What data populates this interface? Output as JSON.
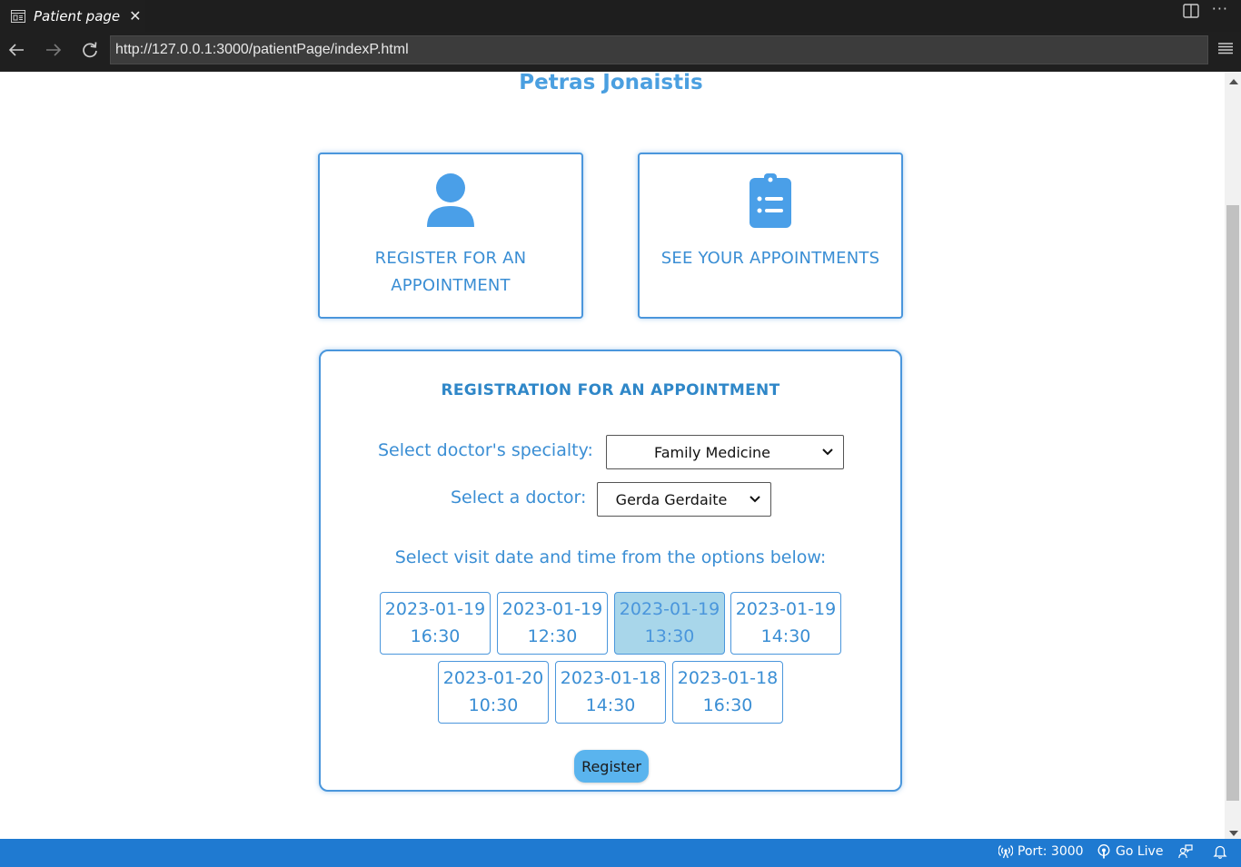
{
  "tab": {
    "title": "Patient page",
    "close_glyph": "✕",
    "icon": "preview-icon"
  },
  "tabbar_actions": {
    "split_icon": "split-editor-icon",
    "more_glyph": "···"
  },
  "addressbar": {
    "url": "http://127.0.0.1:3000/patientPage/indexP.html"
  },
  "page": {
    "patient_name": "Petras Jonaistis",
    "cards": [
      {
        "label": "REGISTER FOR AN APPOINTMENT",
        "icon": "user-icon"
      },
      {
        "label": "SEE YOUR APPOINTMENTS",
        "icon": "clipboard-list-icon"
      }
    ],
    "form": {
      "title": "REGISTRATION FOR AN APPOINTMENT",
      "specialty_label": "Select doctor's specialty:",
      "specialty_value": "Family Medicine",
      "doctor_label": "Select a doctor:",
      "doctor_value": "Gerda Gerdaite",
      "instructions": "Select visit date and time from the options below:",
      "slots": [
        {
          "date": "2023-01-19",
          "time": "16:30",
          "selected": false
        },
        {
          "date": "2023-01-19",
          "time": "12:30",
          "selected": false
        },
        {
          "date": "2023-01-19",
          "time": "13:30",
          "selected": true
        },
        {
          "date": "2023-01-19",
          "time": "14:30",
          "selected": false
        },
        {
          "date": "2023-01-20",
          "time": "10:30",
          "selected": false
        },
        {
          "date": "2023-01-18",
          "time": "14:30",
          "selected": false
        },
        {
          "date": "2023-01-18",
          "time": "16:30",
          "selected": false
        }
      ],
      "register_label": "Register"
    }
  },
  "statusbar": {
    "port_label": "Port: 3000",
    "go_live_label": "Go Live"
  },
  "colors": {
    "accent": "#4a96dc",
    "selected_slot": "#a8d6ea",
    "register_button": "#5ab4ee",
    "statusbar": "#1f7ad1"
  }
}
